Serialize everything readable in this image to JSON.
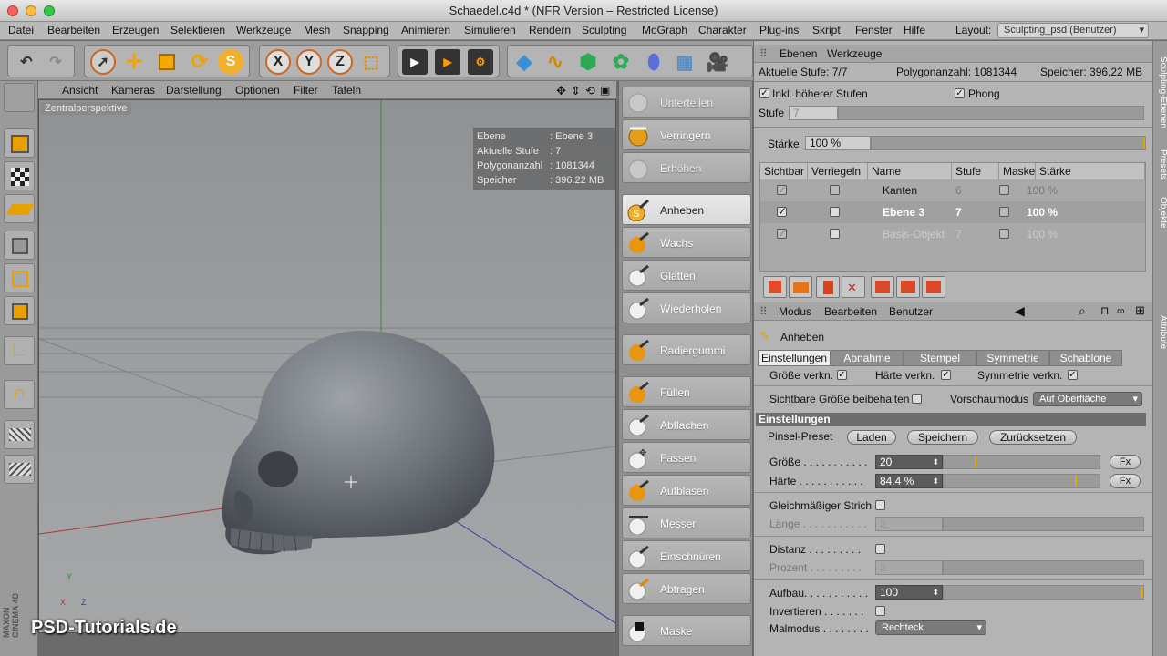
{
  "window": {
    "title": "Schaedel.c4d * (NFR Version – Restricted License)"
  },
  "menu": [
    "Datei",
    "Bearbeiten",
    "Erzeugen",
    "Selektieren",
    "Werkzeuge",
    "Mesh",
    "Snapping",
    "Animieren",
    "Simulieren",
    "Rendern",
    "Sculpting",
    "MoGraph",
    "Charakter",
    "Plug-ins",
    "Skript",
    "Fenster",
    "Hilfe"
  ],
  "layout": {
    "label": "Layout:",
    "value": "Sculpting_psd (Benutzer)"
  },
  "viewport": {
    "menu": [
      "Ansicht",
      "Kameras",
      "Darstellung",
      "Optionen",
      "Filter",
      "Tafeln"
    ],
    "label": "Zentralperspektive",
    "hud": [
      {
        "k": "Ebene",
        "v": ": Ebene 3"
      },
      {
        "k": "Aktuelle Stufe",
        "v": ": 7"
      },
      {
        "k": "Polygonanzahl",
        "v": ": 1081344"
      },
      {
        "k": "Speicher",
        "v": ": 396.22 MB"
      }
    ],
    "axes": {
      "y": "Y",
      "x": "X",
      "z": "Z"
    },
    "watermark": "PSD-Tutorials.de",
    "brand": "MAXON CINEMA 4D"
  },
  "brushes": [
    "Unterteilen",
    "Verringern",
    "Erhöhen",
    "Anheben",
    "Wachs",
    "Glätten",
    "Wiederholen",
    "Radiergummi",
    "Füllen",
    "Abflachen",
    "Fassen",
    "Aufblasen",
    "Messer",
    "Einschnüren",
    "Abtragen",
    "Maske"
  ],
  "layers_panel": {
    "tabs": [
      "Ebenen",
      "Werkzeuge"
    ],
    "aktuelle_stufe": "Aktuelle Stufe: 7/7",
    "polygonanzahl": "Polygonanzahl: 1081344",
    "speicher": "Speicher: 396.22 MB",
    "inkl": "Inkl. höherer Stufen",
    "phong": "Phong",
    "stufe_label": "Stufe",
    "stufe_value": "7",
    "staerke_label": "Stärke",
    "staerke_value": "100 %",
    "columns": [
      "Sichtbar",
      "Verriegeln",
      "Name",
      "Stufe",
      "Maske",
      "Stärke"
    ],
    "rows": [
      {
        "name": "Kanten",
        "stufe": "6",
        "staerke": "100 %"
      },
      {
        "name": "Ebene 3",
        "stufe": "7",
        "staerke": "100 %"
      },
      {
        "name": "Basis-Objekt",
        "stufe": "7",
        "staerke": "100 %"
      }
    ]
  },
  "attributes": {
    "tabs": [
      "Modus",
      "Bearbeiten",
      "Benutzer"
    ],
    "tool_name": "Anheben",
    "subtabs": [
      "Einstellungen",
      "Abnahme",
      "Stempel",
      "Symmetrie",
      "Schablone"
    ],
    "groesse_verkn": "Größe verkn.",
    "haerte_verkn": "Härte verkn.",
    "symmetrie_verkn": "Symmetrie verkn.",
    "sichtbare_groesse": "Sichtbare Größe beibehalten",
    "vorschaumodus_label": "Vorschaumodus",
    "vorschaumodus_value": "Auf Oberfläche",
    "section": "Einstellungen",
    "pinsel_preset": "Pinsel-Preset",
    "laden": "Laden",
    "speichern": "Speichern",
    "zuruecksetzen": "Zurücksetzen",
    "groesse_label": "Größe . . . . . . . . . . .",
    "groesse_value": "20",
    "groesse_fraction": 0.2,
    "haerte_label": "Härte . . . . . . . . . . .",
    "haerte_value": "84.4 %",
    "haerte_fraction": 0.844,
    "fx": "Fx",
    "gleichmaessig": "Gleichmäßiger Strich",
    "laenge_label": "Länge . . . . . . . . . . .",
    "laenge_value": "2",
    "distanz_label": "Distanz . . . . . . . . .",
    "prozent_label": "Prozent . . . . . . . . .",
    "prozent_value": "2",
    "aufbau_label": "Aufbau. . . . . . . . . . .",
    "aufbau_value": "100",
    "invertieren_label": "Invertieren . . . . . . .",
    "malmodus_label": "Malmodus . . . . . . . .",
    "malmodus_value": "Rechteck"
  },
  "side_tabs": [
    "Sculpting-Ebenen",
    "Presets",
    "Objekte",
    "Attribute"
  ]
}
